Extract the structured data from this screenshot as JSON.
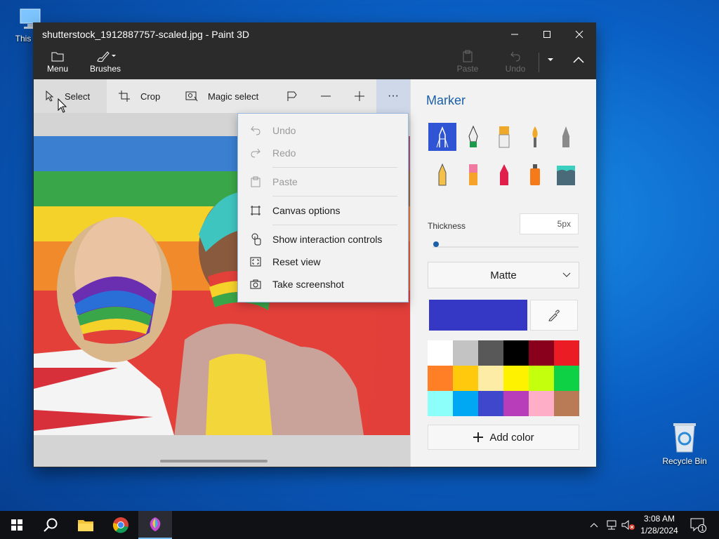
{
  "desktop": {
    "this_pc_label": "This PC",
    "recycle_bin_label": "Recycle Bin"
  },
  "window": {
    "title": "shutterstock_1912887757-scaled.jpg - Paint 3D"
  },
  "ribbon": {
    "menu_label": "Menu",
    "brushes_label": "Brushes",
    "paste_label": "Paste",
    "undo_label": "Undo"
  },
  "toolbar": {
    "select_label": "Select",
    "crop_label": "Crop",
    "magic_select_label": "Magic select",
    "more_label": "···"
  },
  "context_menu": {
    "items": [
      {
        "label": "Undo",
        "icon": "undo-icon",
        "enabled": false
      },
      {
        "label": "Redo",
        "icon": "redo-icon",
        "enabled": false
      },
      {
        "label": "Paste",
        "icon": "paste-icon",
        "enabled": false
      },
      {
        "label": "Canvas options",
        "icon": "canvas-icon",
        "enabled": true
      },
      {
        "label": "Show interaction controls",
        "icon": "touch-icon",
        "enabled": true
      },
      {
        "label": "Reset view",
        "icon": "reset-view-icon",
        "enabled": true
      },
      {
        "label": "Take screenshot",
        "icon": "camera-icon",
        "enabled": true
      }
    ]
  },
  "panel": {
    "title": "Marker",
    "brushes": [
      "marker",
      "calligraphy-pen",
      "oil-brush",
      "watercolor",
      "pixel-pen",
      "pencil",
      "eraser",
      "crayon",
      "spray-can",
      "fill"
    ],
    "selected_brush": "marker",
    "thickness_label": "Thickness",
    "thickness_value": "5px",
    "thickness_level": 0.05,
    "finish": "Matte",
    "current_color": "#3438c4",
    "palette": [
      "#ffffff",
      "#c3c3c3",
      "#585858",
      "#000000",
      "#88001b",
      "#ec1c24",
      "#ff7f27",
      "#ffc90e",
      "#fdeca6",
      "#fff200",
      "#c4ff0e",
      "#0ed145",
      "#8cfffb",
      "#00a8f3",
      "#3f48cc",
      "#b83dba",
      "#ffaec8",
      "#b97a56"
    ],
    "add_color_label": "Add color"
  },
  "taskbar": {
    "time": "3:08 AM",
    "date": "1/28/2024",
    "notification_count": "1"
  }
}
